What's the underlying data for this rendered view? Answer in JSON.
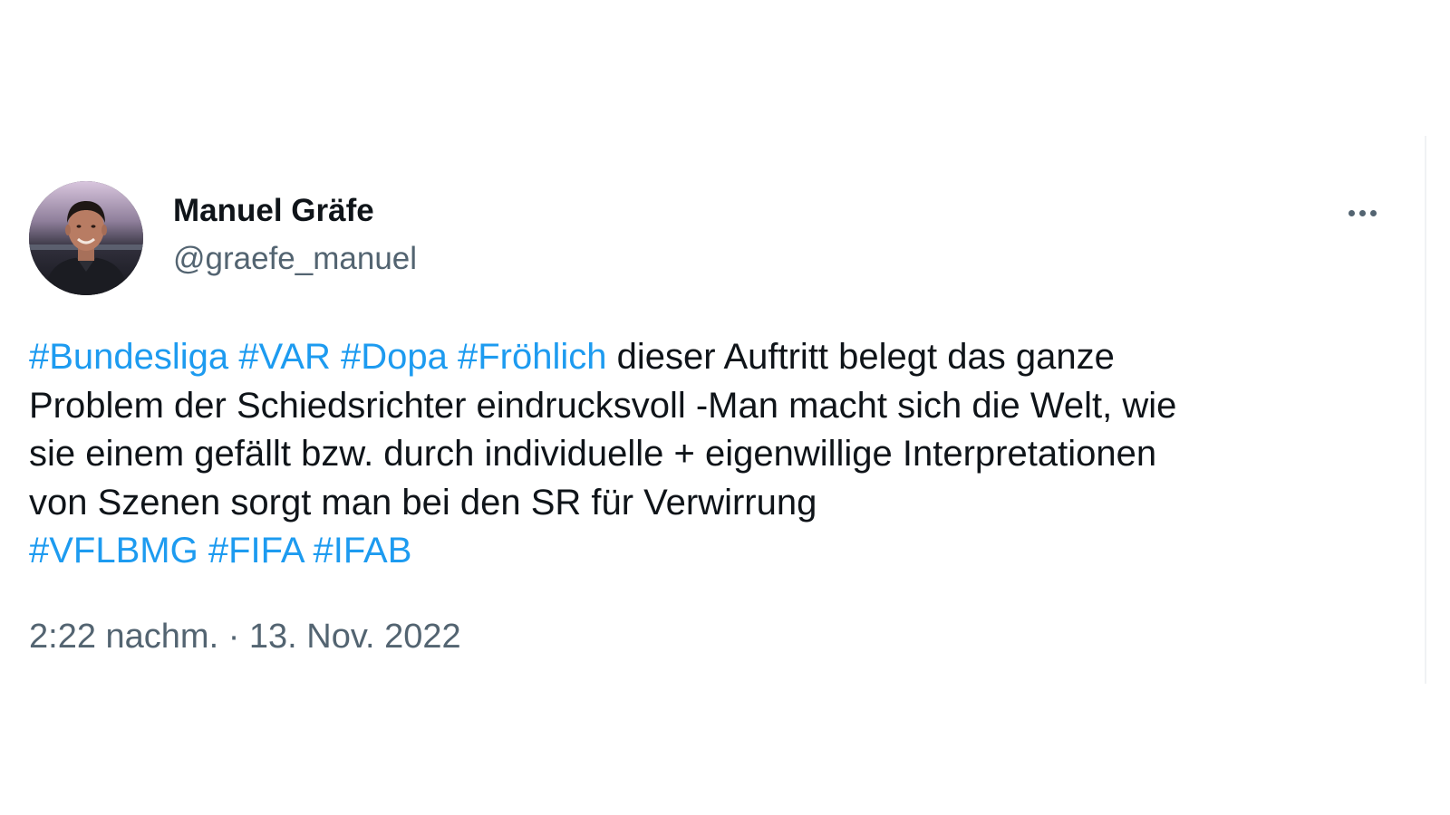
{
  "author": {
    "display_name": "Manuel Gräfe",
    "handle": "@graefe_manuel",
    "avatar_icon": "user-avatar-photo"
  },
  "more_menu": {
    "icon": "more-horizontal-icon"
  },
  "tweet": {
    "line1": {
      "tags": [
        "#Bundesliga",
        "#VAR",
        "#Dopa",
        "#Fröhlich"
      ],
      "text": "dieser Auftritt belegt das ganze"
    },
    "line2": "Problem der Schiedsrichter eindrucksvoll -Man macht sich die Welt, wie",
    "line3": "sie einem gefällt bzw. durch individuelle + eigenwillige Interpretationen",
    "line4": "von Szenen sorgt man bei den SR für Verwirrung",
    "line5_tags": [
      "#VFLBMG",
      "#FIFA",
      "#IFAB"
    ]
  },
  "timestamp": "2:22 nachm. · 13. Nov. 2022",
  "colors": {
    "hashtag": "#1d9bf0",
    "text": "#0f1419",
    "secondary": "#536471"
  }
}
